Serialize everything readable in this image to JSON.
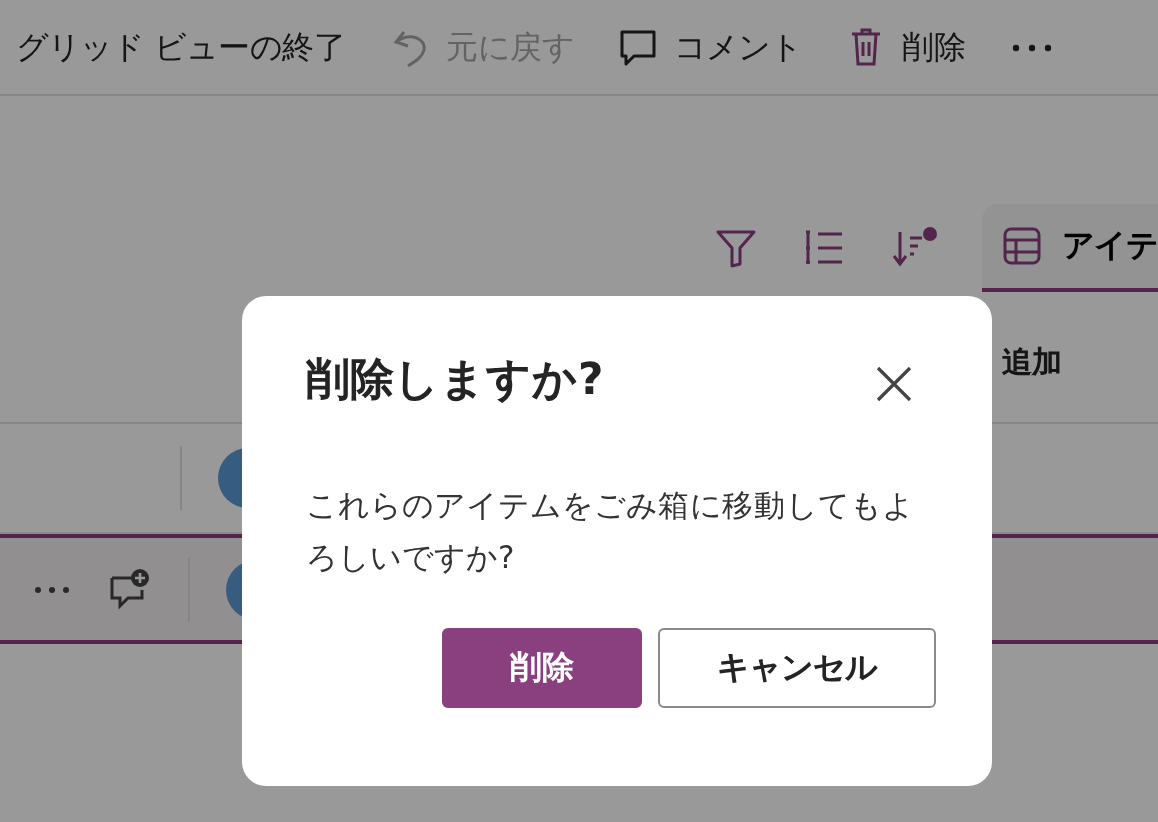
{
  "toolbar": {
    "items": [
      {
        "kind": "exit",
        "label": "グリッド ビューの終了",
        "disabled": false
      },
      {
        "kind": "undo",
        "label": "元に戻す",
        "disabled": true
      },
      {
        "kind": "comment",
        "label": "コメント",
        "disabled": false
      },
      {
        "kind": "delete",
        "label": "削除",
        "disabled": false
      }
    ]
  },
  "view_controls": {
    "sort_active": true,
    "tab": {
      "label": "アイテ",
      "selected": true
    }
  },
  "grid": {
    "header": "追加",
    "rows": [
      {
        "selected": false
      },
      {
        "selected": true
      }
    ]
  },
  "dialog": {
    "title": "削除しますか?",
    "message": "これらのアイテムをごみ箱に移動してもよろしいですか?",
    "buttons": [
      {
        "kind": "primary",
        "label": "削除"
      },
      {
        "kind": "secondary",
        "label": "キャンセル"
      }
    ]
  }
}
